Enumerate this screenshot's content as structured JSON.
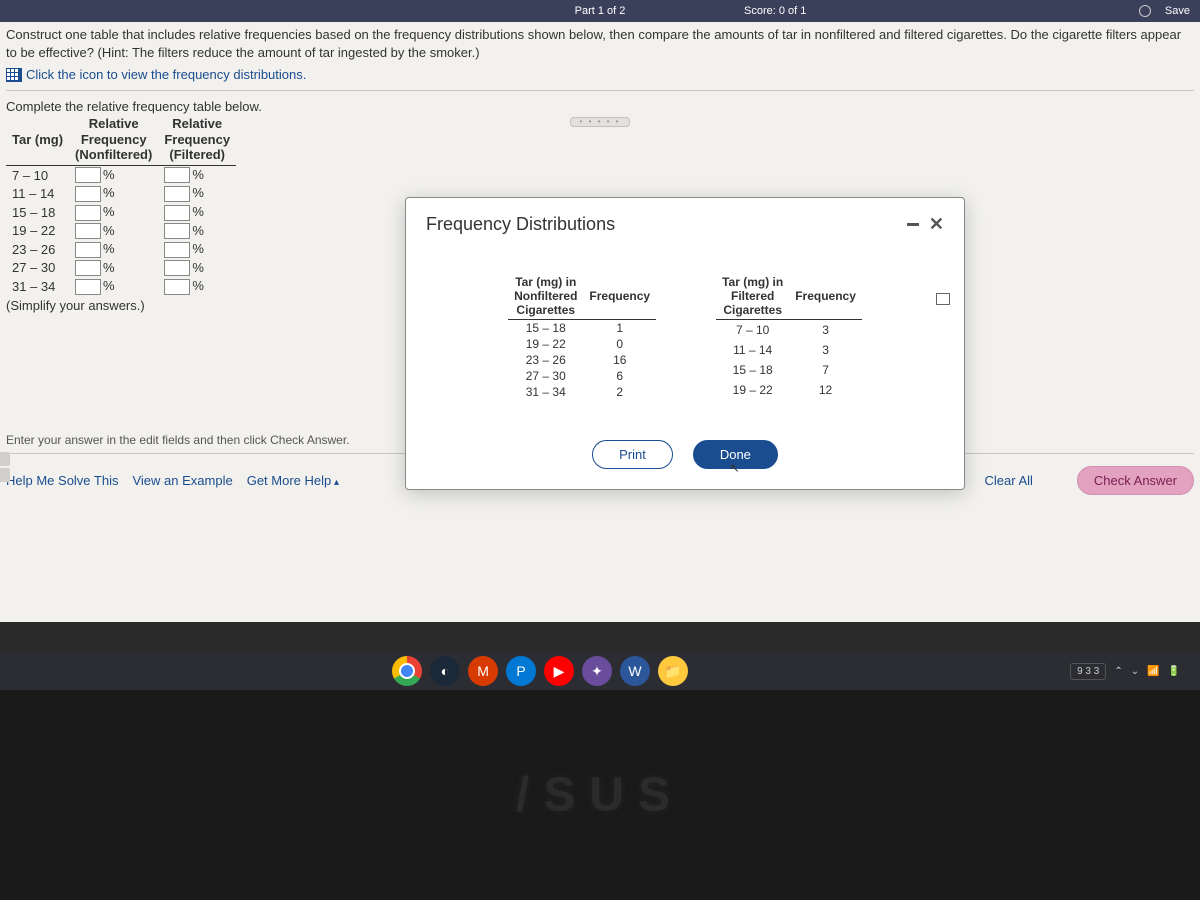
{
  "topbar": {
    "part": "Part 1 of 2",
    "score": "Score: 0 of 1",
    "save": "Save"
  },
  "question": {
    "text": "Construct one table that includes relative frequencies based on the frequency distributions shown below, then compare the amounts of tar in nonfiltered and filtered cigarettes. Do the cigarette filters appear to be effective? (Hint: The filters reduce the amount of tar ingested by the smoker.)",
    "view_link": "Click the icon to view the frequency distributions."
  },
  "input_section": {
    "label": "Complete the relative frequency table below.",
    "header": {
      "col1": "Tar (mg)",
      "col2_l1": "Relative",
      "col2_l2": "Frequency",
      "col2_l3": "(Nonfiltered)",
      "col3_l1": "Relative",
      "col3_l2": "Frequency",
      "col3_l3": "(Filtered)"
    },
    "rows": [
      "7 – 10",
      "11 – 14",
      "15 – 18",
      "19 – 22",
      "23 – 26",
      "27 – 30",
      "31 – 34"
    ],
    "pct": "%",
    "simplify": "(Simplify your answers.)"
  },
  "modal": {
    "title": "Frequency Distributions",
    "nonfiltered": {
      "col1_l1": "Tar (mg) in",
      "col1_l2": "Nonfiltered",
      "col1_l3": "Cigarettes",
      "col2": "Frequency",
      "rows": [
        {
          "range": "15 – 18",
          "freq": "1"
        },
        {
          "range": "19 – 22",
          "freq": "0"
        },
        {
          "range": "23 – 26",
          "freq": "16"
        },
        {
          "range": "27 – 30",
          "freq": "6"
        },
        {
          "range": "31 – 34",
          "freq": "2"
        }
      ]
    },
    "filtered": {
      "col1_l1": "Tar (mg) in",
      "col1_l2": "Filtered",
      "col1_l3": "Cigarettes",
      "col2": "Frequency",
      "rows": [
        {
          "range": "7 – 10",
          "freq": "3"
        },
        {
          "range": "11 – 14",
          "freq": "3"
        },
        {
          "range": "15 – 18",
          "freq": "7"
        },
        {
          "range": "19 – 22",
          "freq": "12"
        }
      ]
    },
    "print": "Print",
    "done": "Done"
  },
  "footer": {
    "hint": "Enter your answer in the edit fields and then click Check Answer.",
    "help": "Help Me Solve This",
    "example": "View an Example",
    "more": "Get More Help",
    "clear": "Clear All",
    "check": "Check Answer"
  },
  "tray": {
    "date": "9 3 3"
  },
  "chart_data": [
    {
      "type": "table",
      "title": "Nonfiltered Cigarettes Tar Frequency",
      "categories": [
        "15 – 18",
        "19 – 22",
        "23 – 26",
        "27 – 30",
        "31 – 34"
      ],
      "values": [
        1,
        0,
        16,
        6,
        2
      ],
      "xlabel": "Tar (mg) in Nonfiltered Cigarettes",
      "ylabel": "Frequency"
    },
    {
      "type": "table",
      "title": "Filtered Cigarettes Tar Frequency",
      "categories": [
        "7 – 10",
        "11 – 14",
        "15 – 18",
        "19 – 22"
      ],
      "values": [
        3,
        3,
        7,
        12
      ],
      "xlabel": "Tar (mg) in Filtered Cigarettes",
      "ylabel": "Frequency"
    }
  ]
}
